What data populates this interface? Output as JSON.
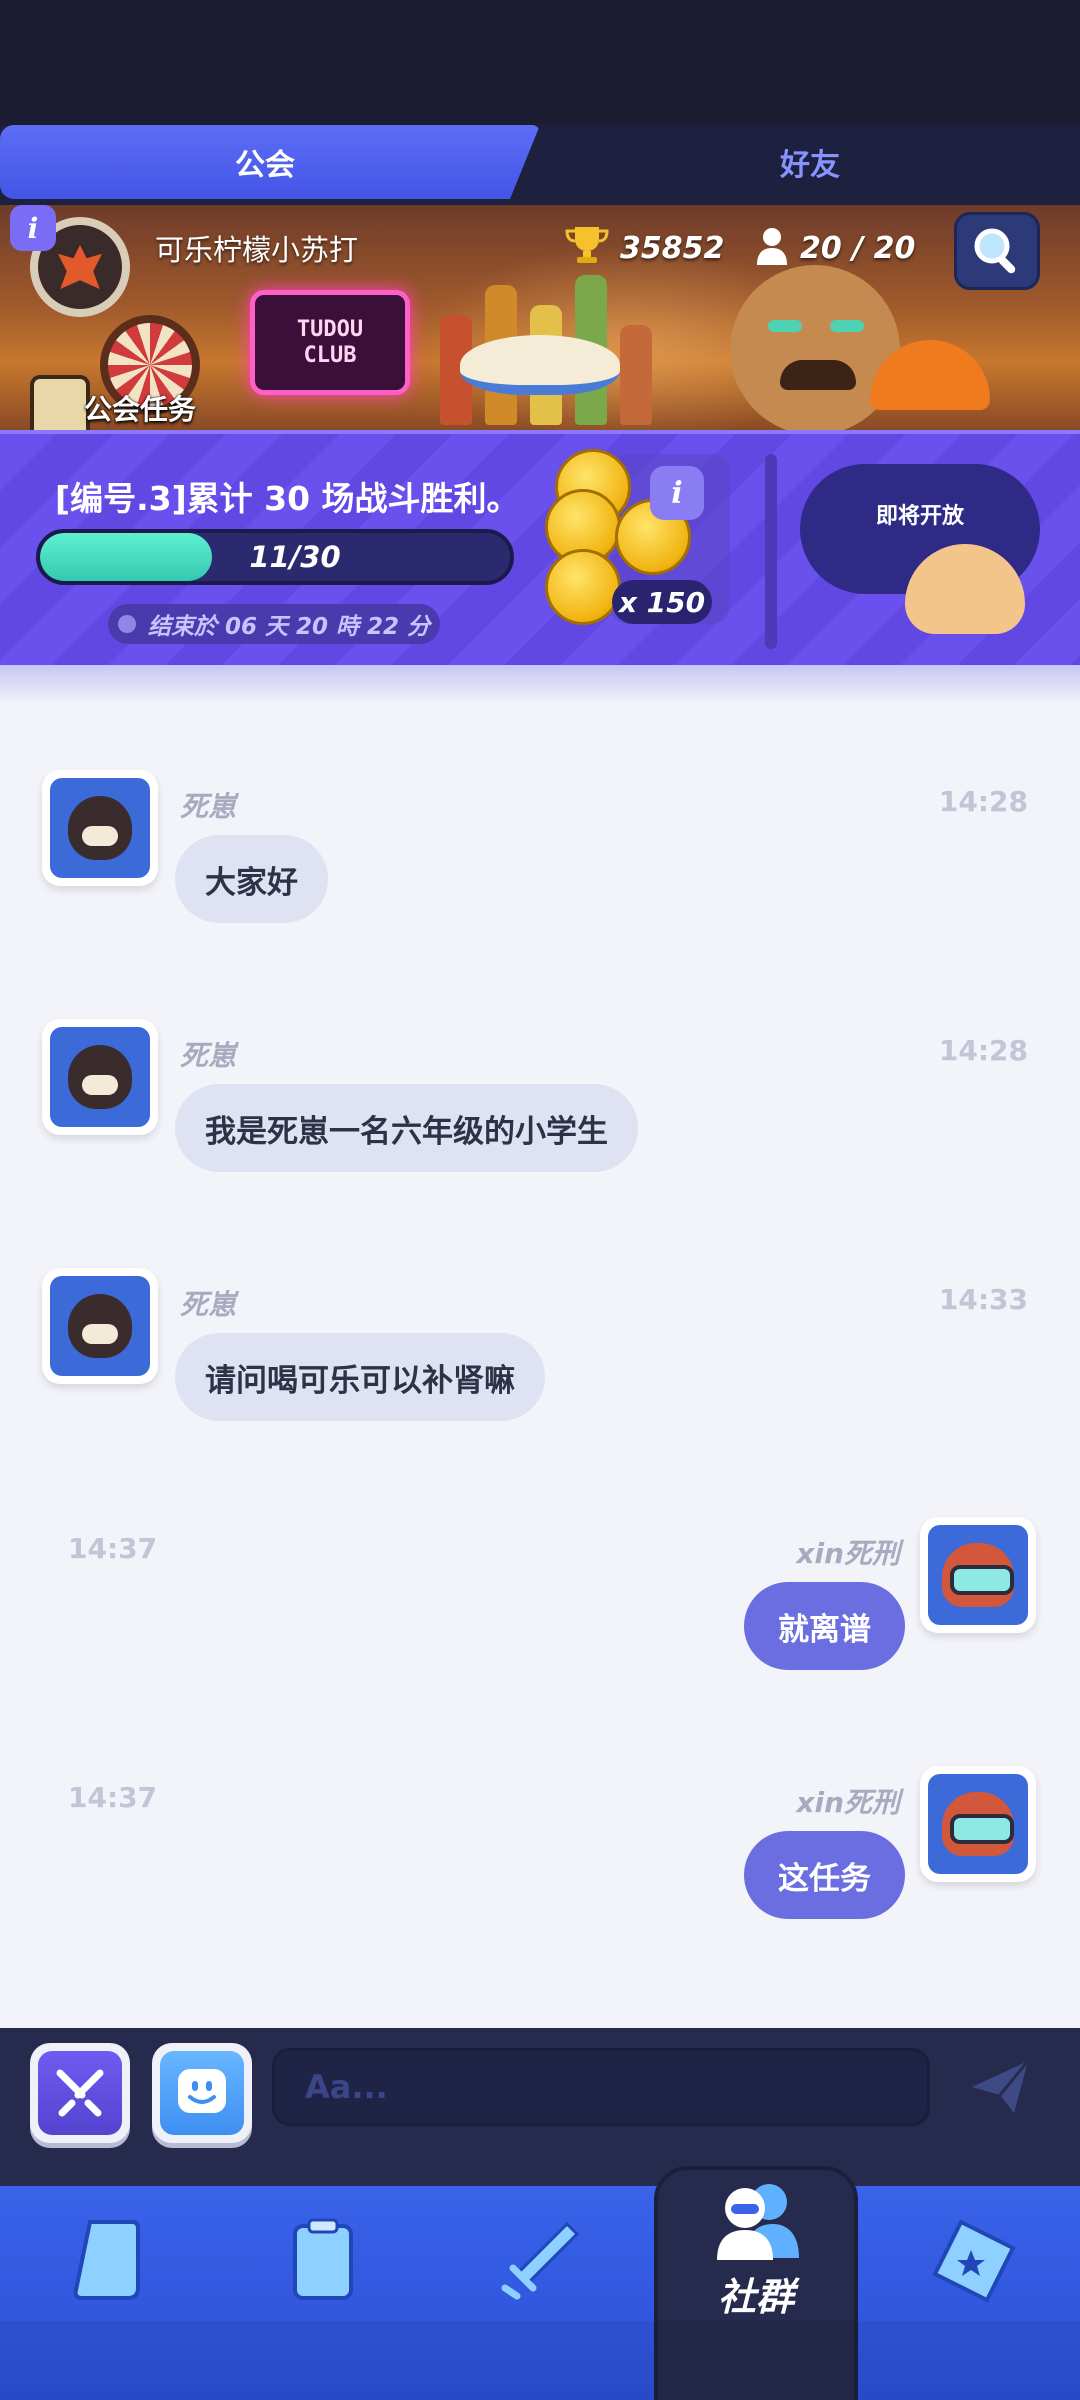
{
  "tabs": {
    "guild": "公会",
    "friends": "好友"
  },
  "guild": {
    "name": "可乐柠檬小苏打",
    "trophies": "35852",
    "members": "20 / 20",
    "neon_sign": [
      "TUDOU",
      "CLUB"
    ]
  },
  "quest": {
    "tag": "公会任务",
    "title": "[编号.3]累计 30 场战斗胜利。",
    "progress_text": "11/30",
    "progress_fraction": 0.3667,
    "deadline": "结束於 06 天 20 時 22 分",
    "reward_qty": "x 150",
    "coming_soon": "即将开放"
  },
  "messages": [
    {
      "sender": "死崽",
      "time": "14:28",
      "text": "大家好",
      "side": "left"
    },
    {
      "sender": "死崽",
      "time": "14:28",
      "text": "我是死崽一名六年级的小学生",
      "side": "left"
    },
    {
      "sender": "死崽",
      "time": "14:33",
      "text": "请问喝可乐可以补肾嘛",
      "side": "left"
    },
    {
      "sender": "xin死刑",
      "time": "14:37",
      "text": "就离谱",
      "side": "right"
    },
    {
      "sender": "xin死刑",
      "time": "14:37",
      "text": "这任务",
      "side": "right"
    }
  ],
  "input": {
    "placeholder": "Aa..."
  },
  "nav": {
    "active_label": "社群"
  },
  "colors": {
    "accent": "#5e6df6",
    "out_bubble": "#6b6ee0",
    "in_bubble": "#dfe2f2",
    "nav": "#3a63ea"
  },
  "icons": [
    "info-icon",
    "trophy-icon",
    "member-icon",
    "search-icon",
    "scroll-icon",
    "clock-icon",
    "coin-icon",
    "send-icon",
    "card-icon",
    "deck-icon",
    "battle-icon",
    "community-icon",
    "ticket-icon"
  ]
}
